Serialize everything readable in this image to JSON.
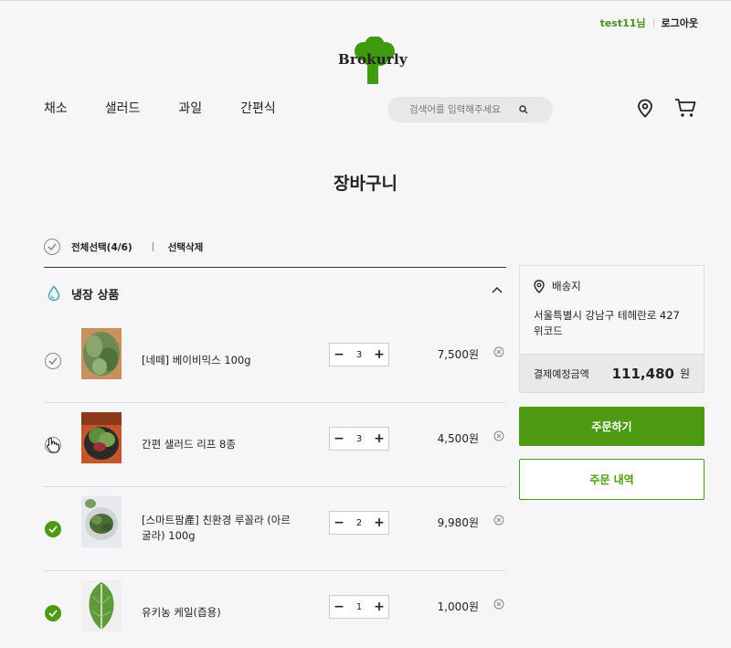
{
  "header": {
    "username": "test11님",
    "logout_label": "로그아웃",
    "logo_text": "Brokurly",
    "nav": [
      "채소",
      "샐러드",
      "과일",
      "간편식"
    ],
    "search_placeholder": "검색어를 입력해주세요"
  },
  "page_title": "장바구니",
  "select_bar": {
    "select_all_label": "전체선택(4/6)",
    "delete_selected_label": "선택삭제"
  },
  "cart": {
    "section_label": "냉장 상품",
    "items": [
      {
        "name": "[네떼] 베이비믹스 100g",
        "quantity": "3",
        "price": "7,500원",
        "checked": false
      },
      {
        "name": "간편 샐러드 리프 8종",
        "quantity": "3",
        "price": "4,500원",
        "checked": false
      },
      {
        "name": "[스마트팜產] 친환경 루꼴라 (아르굴라) 100g",
        "quantity": "2",
        "price": "9,980원",
        "checked": true
      },
      {
        "name": "유키농 케일(즙용)",
        "quantity": "1",
        "price": "1,000원",
        "checked": true
      }
    ]
  },
  "sidebar": {
    "delivery_label": "배송지",
    "address": "서울특별시 강남구 테헤란로 427 위코드",
    "total_label": "결제예정금액",
    "total_amount": "111,480",
    "total_unit": "원",
    "order_button": "주문하기",
    "history_button": "주문 내역"
  },
  "colors": {
    "accent": "#4e9a12",
    "username": "#4a8f1c",
    "background": "#f6f5f7"
  },
  "icons": [
    "search-icon",
    "location-pin-icon",
    "cart-icon",
    "water-drop-icon",
    "chevron-up-icon",
    "check-icon",
    "remove-icon",
    "hand-cursor-icon"
  ]
}
